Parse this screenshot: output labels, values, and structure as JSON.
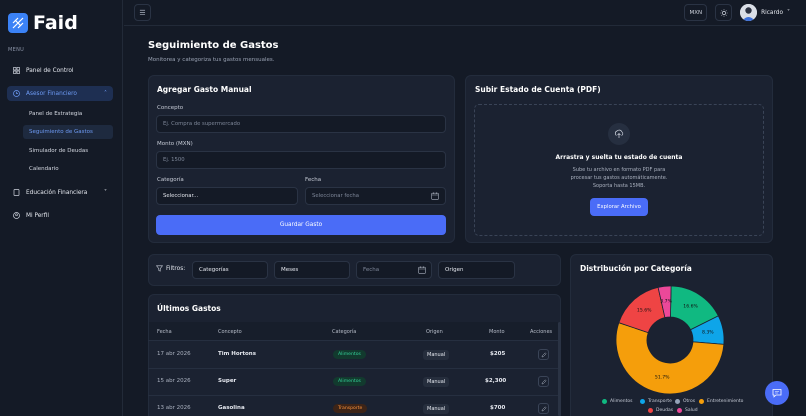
{
  "app": {
    "name": "Faid"
  },
  "sidebar": {
    "menu_label": "MENU",
    "items": [
      {
        "label": "Panel de Control",
        "icon": "grid-icon"
      },
      {
        "label": "Asesor Financiero",
        "icon": "clock-icon"
      },
      {
        "label": "Educación Financiera",
        "icon": "book-icon"
      },
      {
        "label": "Mi Perfil",
        "icon": "user-icon"
      }
    ],
    "sub_items": [
      {
        "label": "Panel de Estrategia"
      },
      {
        "label": "Seguimiento de Gastos"
      },
      {
        "label": "Simulador de Deudas"
      },
      {
        "label": "Calendario"
      }
    ]
  },
  "topbar": {
    "currency": "MXN",
    "user_name": "Ricardo"
  },
  "page": {
    "title": "Seguimiento de Gastos",
    "subtitle": "Monitorea y categoriza tus gastos mensuales."
  },
  "manual_form": {
    "title": "Agregar Gasto Manual",
    "concept_label": "Concepto",
    "concept_placeholder": "Ej. Compra de supermercado",
    "amount_label": "Monto (MXN)",
    "amount_placeholder": "Ej. 1500",
    "category_label": "Categoría",
    "category_value": "Seleccionar...",
    "date_label": "Fecha",
    "date_placeholder": "Seleccionar fecha",
    "save_label": "Guardar Gasto"
  },
  "upload": {
    "title": "Subir Estado de Cuenta (PDF)",
    "heading": "Arrastra y suelta tu estado de cuenta",
    "line1": "Sube tu archivo en formato PDF para",
    "line2": "procesar tus gastos automáticamente.",
    "line3": "Soporta hasta 15MB.",
    "button": "Explorar Archivo"
  },
  "filters": {
    "label": "Filtros:",
    "categories": "Categorías",
    "months": "Meses",
    "date": "Fecha",
    "origin": "Origen"
  },
  "expenses": {
    "title": "Últimos Gastos",
    "headers": {
      "date": "Fecha",
      "concept": "Concepto",
      "category": "Categoría",
      "origin": "Origen",
      "amount": "Monto",
      "actions": "Acciones"
    },
    "rows": [
      {
        "date": "17 abr 2026",
        "concept": "Tim Hortons",
        "category": "Alimentos",
        "origin": "Manual",
        "amount": "$205"
      },
      {
        "date": "15 abr 2026",
        "concept": "Super",
        "category": "Alimentos",
        "origin": "Manual",
        "amount": "$2,300"
      },
      {
        "date": "13 abr 2026",
        "concept": "Gasolina",
        "category": "Transporte",
        "origin": "Manual",
        "amount": "$700"
      }
    ]
  },
  "chart_data": {
    "type": "pie",
    "title": "Distribución por Categoría",
    "slices": [
      {
        "name": "Alimentos",
        "value": 16.6,
        "label": "16.6%",
        "color": "#10b981"
      },
      {
        "name": "Transporte",
        "value": 8.3,
        "label": "8.3%",
        "color": "#0ea5e9"
      },
      {
        "name": "Otros",
        "value": 0.0,
        "label": "",
        "color": "#94a3b8"
      },
      {
        "name": "Entretenimiento",
        "value": 51.7,
        "label": "51.7%",
        "color": "#f59e0b"
      },
      {
        "name": "Deudas",
        "value": 15.6,
        "label": "15.6%",
        "color": "#ef4444"
      },
      {
        "name": "Salud",
        "value": 3.7,
        "label": "3.7%",
        "color": "#ec4899"
      }
    ],
    "legend": [
      "Alimentos",
      "Transporte",
      "Otros",
      "Entretenimiento",
      "Deudas",
      "Salud"
    ]
  },
  "colors": {
    "accent": "#4a6cf7",
    "bg": "#141a26",
    "card": "#1b2231"
  }
}
